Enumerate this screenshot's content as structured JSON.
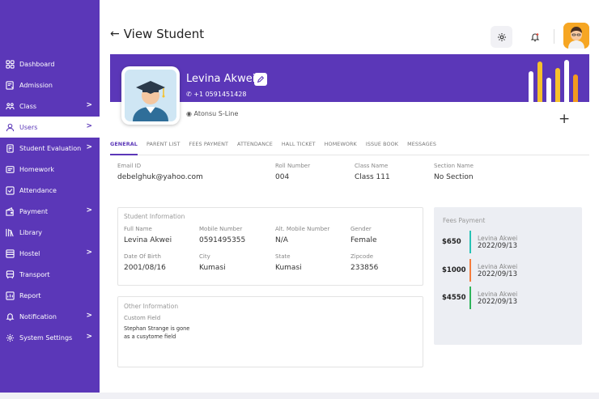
{
  "header": {
    "title": "View Student"
  },
  "sidebar": {
    "items": [
      {
        "label": "Dashboard",
        "icon": "grid-icon",
        "chevron": false
      },
      {
        "label": "Admission",
        "icon": "admission-icon",
        "chevron": false
      },
      {
        "label": "Class",
        "icon": "class-icon",
        "chevron": true
      },
      {
        "label": "Users",
        "icon": "user-icon",
        "chevron": true,
        "active": true
      },
      {
        "label": "Student Evaluation",
        "icon": "evaluation-icon",
        "chevron": true
      },
      {
        "label": "Homework",
        "icon": "homework-icon",
        "chevron": false
      },
      {
        "label": "Attendance",
        "icon": "attendance-icon",
        "chevron": false
      },
      {
        "label": "Payment",
        "icon": "payment-icon",
        "chevron": true
      },
      {
        "label": "Library",
        "icon": "library-icon",
        "chevron": false
      },
      {
        "label": "Hostel",
        "icon": "hostel-icon",
        "chevron": true
      },
      {
        "label": "Transport",
        "icon": "transport-icon",
        "chevron": false
      },
      {
        "label": "Report",
        "icon": "report-icon",
        "chevron": false
      },
      {
        "label": "Notification",
        "icon": "notification-icon",
        "chevron": true
      },
      {
        "label": "System Settings",
        "icon": "settings-icon",
        "chevron": true
      }
    ],
    "chevron": ">"
  },
  "profile": {
    "name": "Levina Akwei",
    "phone": "+1 0591451428",
    "location": "Atonsu S-Line"
  },
  "tabs": [
    "GENERAL",
    "PARENT LIST",
    "FEES PAYMENT",
    "ATTENDANCE",
    "HALL TICKET",
    "HOMEWORK",
    "ISSUE BOOK",
    "MESSAGES"
  ],
  "general": {
    "email_label": "Email ID",
    "email": "debelghuk@yahoo.com",
    "roll_label": "Roll Number",
    "roll": "004",
    "class_label": "Class Name",
    "class": "Class 111",
    "section_label": "Section Name",
    "section": "No Section"
  },
  "student_info": {
    "title": "Student Information",
    "full_name_label": "Full Name",
    "full_name": "Levina Akwei",
    "mobile_label": "Mobile Number",
    "mobile": "0591495355",
    "alt_mobile_label": "Alt. Mobile Number",
    "alt_mobile": "N/A",
    "gender_label": "Gender",
    "gender": "Female",
    "dob_label": "Date Of Birth",
    "dob": "2001/08/16",
    "city_label": "City",
    "city": "Kumasi",
    "state_label": "State",
    "state": "Kumasi",
    "zip_label": "Zipcode",
    "zip": "233856"
  },
  "other_info": {
    "title": "Other Information",
    "custom_label": "Custom Field",
    "custom_value": "Stephan Strange is gone as a cusytome field"
  },
  "fees": {
    "title": "Fees Payment",
    "items": [
      {
        "amount": "$650",
        "name": "Levina Akwei",
        "date": "2022/09/13",
        "color": "#27c2b5"
      },
      {
        "amount": "$1000",
        "name": "Levina Akwei",
        "date": "2022/09/13",
        "color": "#f47c3c"
      },
      {
        "amount": "$4550",
        "name": "Levina Akwei",
        "date": "2022/09/13",
        "color": "#2fb35a"
      }
    ]
  },
  "colors": {
    "primary": "#5b37b8",
    "accent_yellow": "#f6c12b",
    "accent_orange": "#f39a1e",
    "notify_red": "#e74c3c"
  }
}
